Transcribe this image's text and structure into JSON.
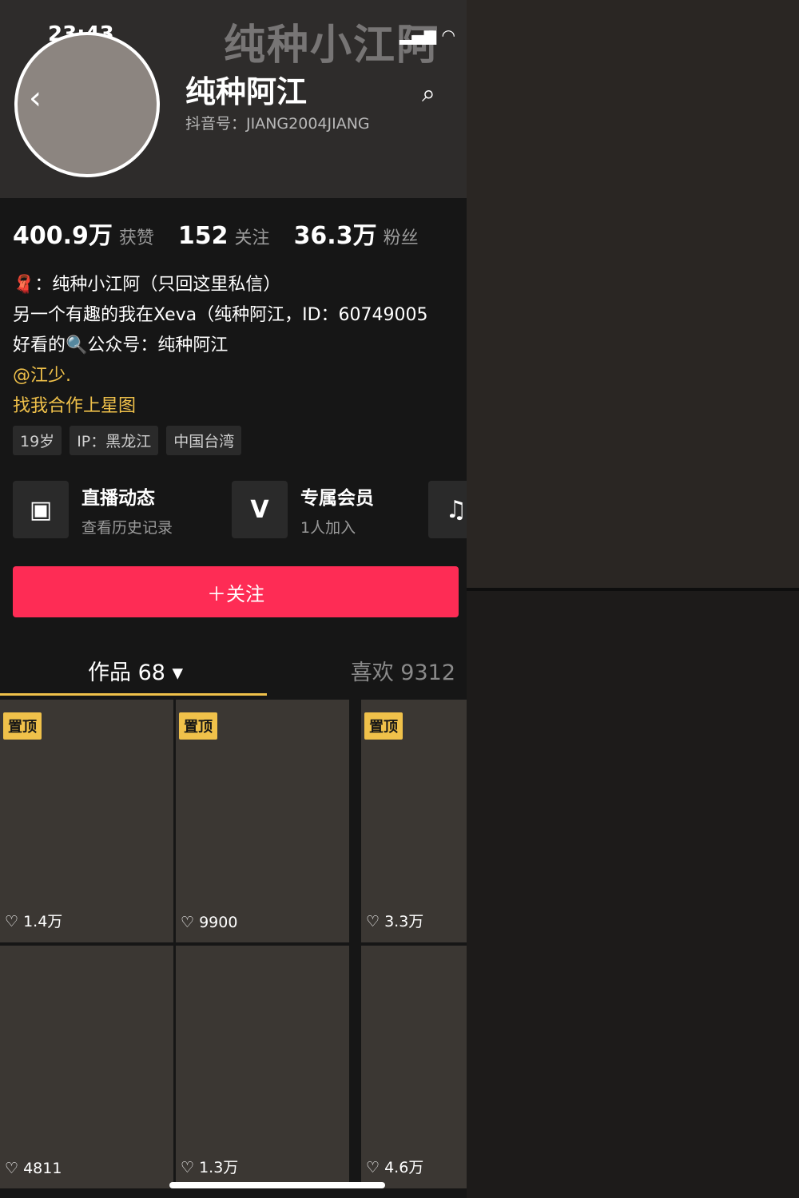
{
  "status": {
    "time": "23:43"
  },
  "header": {
    "bg_name": "纯种小江阿",
    "nickname": "纯种阿江",
    "handle": "抖音号：JIANG2004JIANG"
  },
  "stats": [
    {
      "value": "400.9万",
      "label": "获赞"
    },
    {
      "value": "152",
      "label": "关注"
    },
    {
      "value": "36.3万",
      "label": "粉丝"
    }
  ],
  "bio": {
    "line1": "🧣：纯种小江阿（只回这里私信）",
    "line2": "另一个有趣的我在Xeva（纯种阿江，ID：60749005",
    "line3": "好看的🔍公众号：纯种阿江",
    "mention": "@江少.",
    "cta": "找我合作上星图"
  },
  "tags": [
    "19岁",
    "IP：黑龙江",
    "中国台湾"
  ],
  "features": [
    {
      "icon": "tv-icon",
      "title": "直播动态",
      "sub": "查看历史记录"
    },
    {
      "icon": "v-icon",
      "title": "专属会员",
      "sub": "1人加入"
    }
  ],
  "follow_label": "＋关注",
  "tabs": {
    "works": "作品 68 ▾",
    "likes": "喜欢 9312"
  },
  "grid": [
    {
      "pinned": "置顶",
      "likes": "♡ 1.4万"
    },
    {
      "pinned": "置顶",
      "likes": "♡ 9900"
    },
    {
      "pinned": "置顶",
      "likes": "♡ 3.3万"
    },
    {
      "pinned": "",
      "likes": "♡ 4811"
    },
    {
      "pinned": "",
      "likes": "♡ 1.3万"
    },
    {
      "pinned": "",
      "likes": "♡ 4.6万"
    }
  ]
}
